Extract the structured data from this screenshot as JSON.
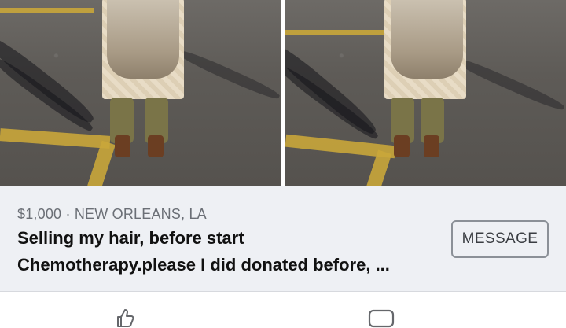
{
  "listing": {
    "price_location": "$1,000 · NEW ORLEANS, LA",
    "title_line1": "Selling my hair, before start",
    "title_line2": "Chemotherapy.please I did donated before, ...",
    "message_label": "MESSAGE"
  },
  "actions": {
    "like_icon": "thumbs-up-icon",
    "comment_icon": "comment-icon"
  },
  "colors": {
    "card_bg": "#eef0f4",
    "meta_text": "#6b6f76",
    "title_text": "#111111",
    "button_border": "#8b9097"
  }
}
